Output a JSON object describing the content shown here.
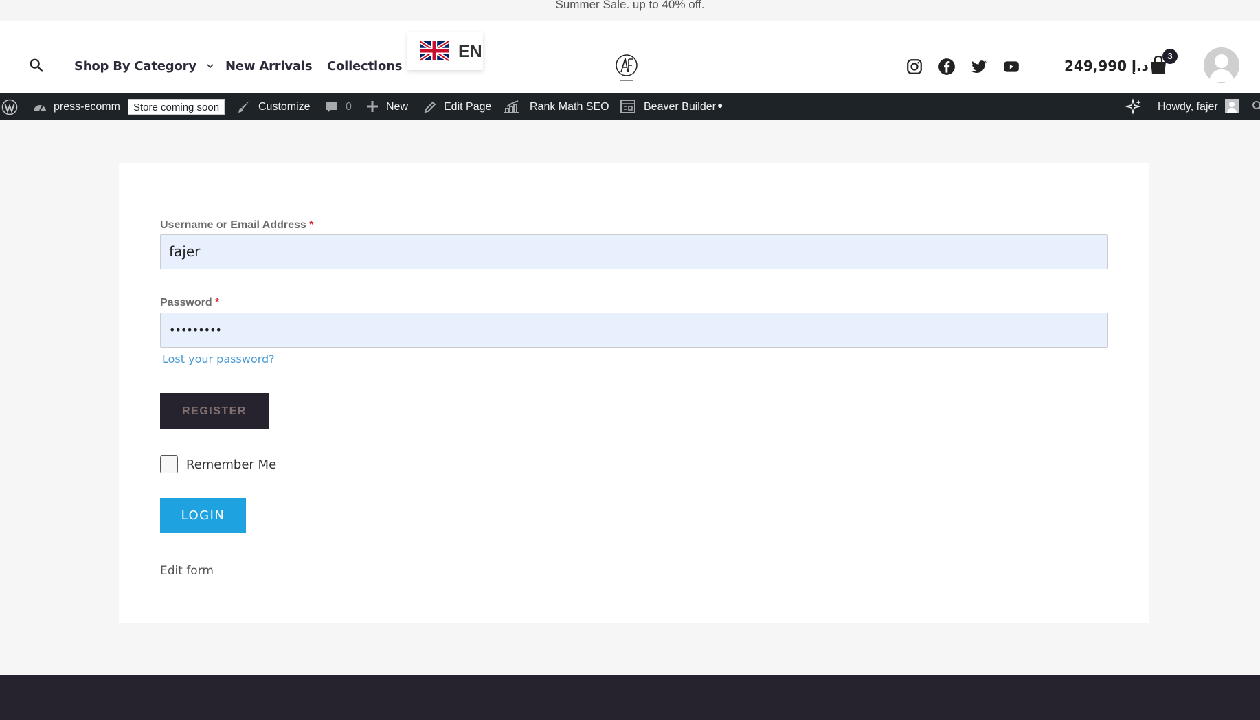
{
  "promo": {
    "text": "Summer Sale. up to 40% off."
  },
  "header": {
    "nav": [
      "Shop By Category",
      "New Arrivals",
      "Collections"
    ],
    "language": {
      "code": "EN",
      "flag_icon": "uk-flag-icon"
    },
    "logo_icon": "af-creative-logo-icon",
    "social_icons": [
      "instagram-icon",
      "facebook-icon",
      "twitter-icon",
      "youtube-icon"
    ],
    "price": "د.إ 249,990",
    "cart_count": "3",
    "avatar_icon": "user-avatar-icon"
  },
  "adminbar": {
    "site_name": "press-ecomm",
    "status_badge": "Store coming soon",
    "customize": "Customize",
    "comments_count": "0",
    "new": "New",
    "edit_page": "Edit Page",
    "rank_math": "Rank Math SEO",
    "beaver_builder": "Beaver Builder",
    "howdy": "Howdy, fajer"
  },
  "form": {
    "username_label": "Username or Email Address",
    "username_value": "fajer",
    "password_label": "Password",
    "password_value": "•••••••••",
    "required_mark": "*",
    "lost_password": "Lost your password?",
    "register_label": "REGISTER",
    "remember_label": "Remember Me",
    "login_label": "LOGIN",
    "edit_form": "Edit form"
  },
  "colors": {
    "accent": "#1ea3e0",
    "dark": "#26232f",
    "admin_bar": "#1d2327",
    "input_bg": "#e8f0fe"
  }
}
